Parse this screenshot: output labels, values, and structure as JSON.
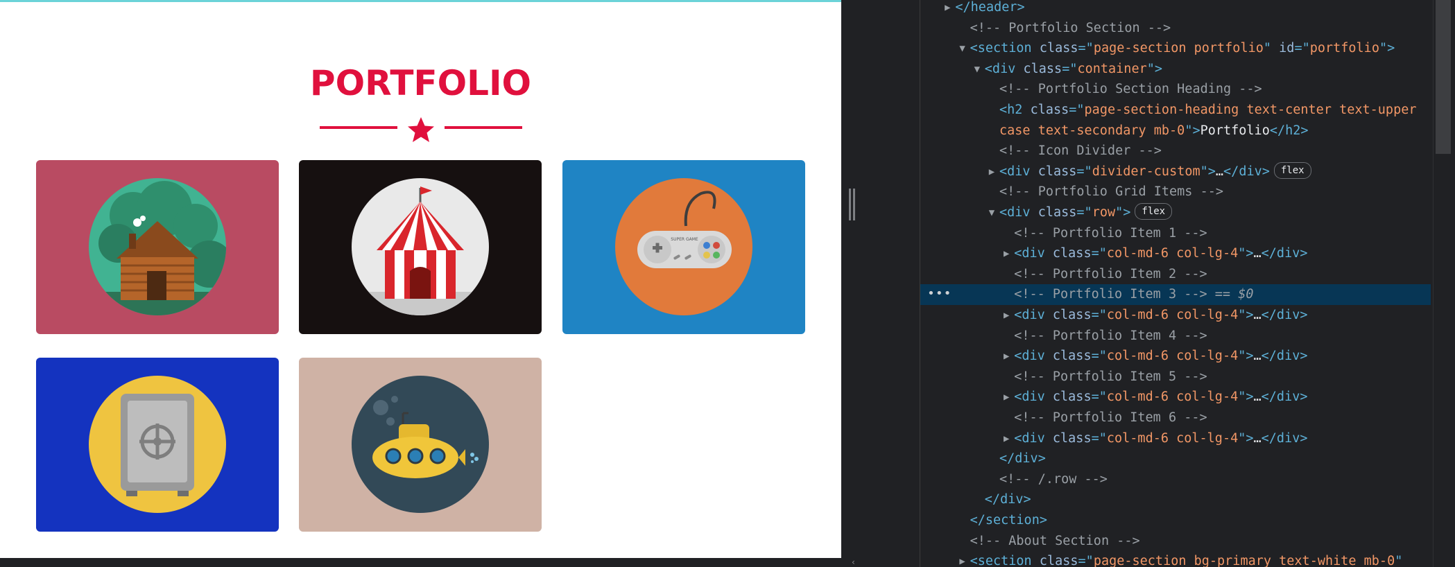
{
  "preview": {
    "heading": "PORTFOLIO",
    "accent_color": "#e0103d",
    "items": [
      {
        "name": "cabin",
        "bg": "#b94b62",
        "icon": "log-cabin-icon"
      },
      {
        "name": "circus",
        "bg": "#161010",
        "icon": "circus-tent-icon"
      },
      {
        "name": "game",
        "bg": "#1f84c4",
        "icon": "game-controller-icon"
      },
      {
        "name": "safe",
        "bg": "#1433bf",
        "icon": "safe-icon"
      },
      {
        "name": "submarine",
        "bg": "#cfb2a5",
        "icon": "submarine-icon"
      }
    ],
    "controller_badge": "SUPER GAME"
  },
  "devtools": {
    "lines": [
      {
        "d": 2,
        "t": "closed",
        "p": [
          [
            "tag",
            "</"
          ],
          [
            "tag",
            "header"
          ],
          [
            "tag",
            ">"
          ]
        ]
      },
      {
        "d": 3,
        "t": "none",
        "p": [
          [
            "cmt",
            "<!-- Portfolio Section -->"
          ]
        ]
      },
      {
        "d": 3,
        "t": "open",
        "p": [
          [
            "tag",
            "<section "
          ],
          [
            "attr",
            "class"
          ],
          [
            "tag",
            "=\""
          ],
          [
            "val",
            "page-section portfolio"
          ],
          [
            "tag",
            "\" "
          ],
          [
            "attr",
            "id"
          ],
          [
            "tag",
            "=\""
          ],
          [
            "val",
            "portfolio"
          ],
          [
            "tag",
            "\">"
          ]
        ]
      },
      {
        "d": 4,
        "t": "open",
        "p": [
          [
            "tag",
            "<div "
          ],
          [
            "attr",
            "class"
          ],
          [
            "tag",
            "=\""
          ],
          [
            "val",
            "container"
          ],
          [
            "tag",
            "\">"
          ]
        ]
      },
      {
        "d": 5,
        "t": "none",
        "p": [
          [
            "cmt",
            "<!-- Portfolio Section Heading -->"
          ]
        ]
      },
      {
        "d": 5,
        "t": "none",
        "p": [
          [
            "tag",
            "<h2 "
          ],
          [
            "attr",
            "class"
          ],
          [
            "tag",
            "=\""
          ],
          [
            "val",
            "page-section-heading text-center text-upper"
          ]
        ]
      },
      {
        "d": 5,
        "t": "none",
        "p": [
          [
            "val",
            "case text-secondary mb-0"
          ],
          [
            "tag",
            "\">"
          ],
          [
            "txt",
            "Portfolio"
          ],
          [
            "tag",
            "</h2>"
          ]
        ]
      },
      {
        "d": 5,
        "t": "none",
        "p": [
          [
            "cmt",
            "<!-- Icon Divider -->"
          ]
        ]
      },
      {
        "d": 5,
        "t": "closed",
        "p": [
          [
            "tag",
            "<div "
          ],
          [
            "attr",
            "class"
          ],
          [
            "tag",
            "=\""
          ],
          [
            "val",
            "divider-custom"
          ],
          [
            "tag",
            "\">"
          ],
          [
            "txt",
            "…"
          ],
          [
            "tag",
            "</div>"
          ]
        ],
        "badge": "flex"
      },
      {
        "d": 5,
        "t": "none",
        "p": [
          [
            "cmt",
            "<!-- Portfolio Grid Items -->"
          ]
        ]
      },
      {
        "d": 5,
        "t": "open",
        "p": [
          [
            "tag",
            "<div "
          ],
          [
            "attr",
            "class"
          ],
          [
            "tag",
            "=\""
          ],
          [
            "val",
            "row"
          ],
          [
            "tag",
            "\">"
          ]
        ],
        "badge": "flex"
      },
      {
        "d": 6,
        "t": "none",
        "p": [
          [
            "cmt",
            "<!-- Portfolio Item 1 -->"
          ]
        ]
      },
      {
        "d": 6,
        "t": "closed",
        "p": [
          [
            "tag",
            "<div "
          ],
          [
            "attr",
            "class"
          ],
          [
            "tag",
            "=\""
          ],
          [
            "val",
            "col-md-6 col-lg-4"
          ],
          [
            "tag",
            "\">"
          ],
          [
            "txt",
            "…"
          ],
          [
            "tag",
            "</div>"
          ]
        ]
      },
      {
        "d": 6,
        "t": "none",
        "p": [
          [
            "cmt",
            "<!-- Portfolio Item 2 -->"
          ]
        ]
      },
      {
        "d": 6,
        "t": "none",
        "p": [
          [
            "cmt",
            "<!-- Portfolio Item 3 -->"
          ],
          [
            "eq",
            " == $0"
          ]
        ],
        "selected": true
      },
      {
        "d": 6,
        "t": "closed",
        "p": [
          [
            "tag",
            "<div "
          ],
          [
            "attr",
            "class"
          ],
          [
            "tag",
            "=\""
          ],
          [
            "val",
            "col-md-6 col-lg-4"
          ],
          [
            "tag",
            "\">"
          ],
          [
            "txt",
            "…"
          ],
          [
            "tag",
            "</div>"
          ]
        ]
      },
      {
        "d": 6,
        "t": "none",
        "p": [
          [
            "cmt",
            "<!-- Portfolio Item 4 -->"
          ]
        ]
      },
      {
        "d": 6,
        "t": "closed",
        "p": [
          [
            "tag",
            "<div "
          ],
          [
            "attr",
            "class"
          ],
          [
            "tag",
            "=\""
          ],
          [
            "val",
            "col-md-6 col-lg-4"
          ],
          [
            "tag",
            "\">"
          ],
          [
            "txt",
            "…"
          ],
          [
            "tag",
            "</div>"
          ]
        ]
      },
      {
        "d": 6,
        "t": "none",
        "p": [
          [
            "cmt",
            "<!-- Portfolio Item 5 -->"
          ]
        ]
      },
      {
        "d": 6,
        "t": "closed",
        "p": [
          [
            "tag",
            "<div "
          ],
          [
            "attr",
            "class"
          ],
          [
            "tag",
            "=\""
          ],
          [
            "val",
            "col-md-6 col-lg-4"
          ],
          [
            "tag",
            "\">"
          ],
          [
            "txt",
            "…"
          ],
          [
            "tag",
            "</div>"
          ]
        ]
      },
      {
        "d": 6,
        "t": "none",
        "p": [
          [
            "cmt",
            "<!-- Portfolio Item 6 -->"
          ]
        ]
      },
      {
        "d": 6,
        "t": "closed",
        "p": [
          [
            "tag",
            "<div "
          ],
          [
            "attr",
            "class"
          ],
          [
            "tag",
            "=\""
          ],
          [
            "val",
            "col-md-6 col-lg-4"
          ],
          [
            "tag",
            "\">"
          ],
          [
            "txt",
            "…"
          ],
          [
            "tag",
            "</div>"
          ]
        ]
      },
      {
        "d": 5,
        "t": "none",
        "p": [
          [
            "tag",
            "</div>"
          ]
        ]
      },
      {
        "d": 5,
        "t": "none",
        "p": [
          [
            "cmt",
            "<!-- /.row -->"
          ]
        ]
      },
      {
        "d": 4,
        "t": "none",
        "p": [
          [
            "tag",
            "</div>"
          ]
        ]
      },
      {
        "d": 3,
        "t": "none",
        "p": [
          [
            "tag",
            "</section>"
          ]
        ]
      },
      {
        "d": 3,
        "t": "none",
        "p": [
          [
            "cmt",
            "<!-- About Section -->"
          ]
        ]
      },
      {
        "d": 3,
        "t": "closed",
        "p": [
          [
            "tag",
            "<section "
          ],
          [
            "attr",
            "class"
          ],
          [
            "tag",
            "=\""
          ],
          [
            "val",
            "page-section bg-primary text-white mb-0"
          ],
          [
            "tag",
            "\""
          ]
        ]
      }
    ]
  }
}
